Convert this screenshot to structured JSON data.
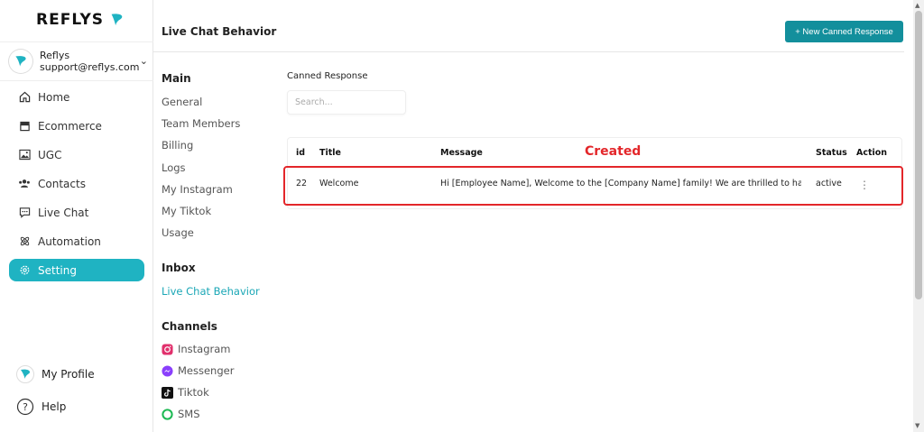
{
  "brand": {
    "name": "REFLYS",
    "accent": "#1fb3c2"
  },
  "account": {
    "name": "Reflys",
    "email": "support@reflys.com"
  },
  "sidebar": {
    "items": [
      {
        "label": "Home",
        "icon": "home-icon"
      },
      {
        "label": "Ecommerce",
        "icon": "store-icon"
      },
      {
        "label": "UGC",
        "icon": "image-icon"
      },
      {
        "label": "Contacts",
        "icon": "users-icon"
      },
      {
        "label": "Live Chat",
        "icon": "chat-icon"
      },
      {
        "label": "Automation",
        "icon": "atom-icon"
      },
      {
        "label": "Setting",
        "icon": "gear-icon",
        "active": true
      }
    ],
    "profile": "My Profile",
    "help": "Help"
  },
  "page": {
    "title": "Live Chat Behavior"
  },
  "settings": {
    "main_title": "Main",
    "main_links": [
      "General",
      "Team Members",
      "Billing",
      "Logs",
      "My Instagram",
      "My Tiktok",
      "Usage"
    ],
    "inbox_title": "Inbox",
    "inbox_links": [
      "Live Chat Behavior"
    ],
    "channels_title": "Channels",
    "channels": [
      "Instagram",
      "Messenger",
      "Tiktok",
      "SMS"
    ]
  },
  "main": {
    "new_button": "+ New Canned Response",
    "section_label": "Canned Response",
    "search_placeholder": "Search...",
    "annotation": "Created",
    "table": {
      "headers": [
        "id",
        "Title",
        "Message",
        "Status",
        "Action"
      ],
      "rows": [
        {
          "id": "22",
          "title": "Welcome",
          "message": "Hi [Employee Name], Welcome to the [Company Name] family! We are thrilled to have yo...",
          "status": "active",
          "action": "⋮"
        }
      ]
    }
  }
}
